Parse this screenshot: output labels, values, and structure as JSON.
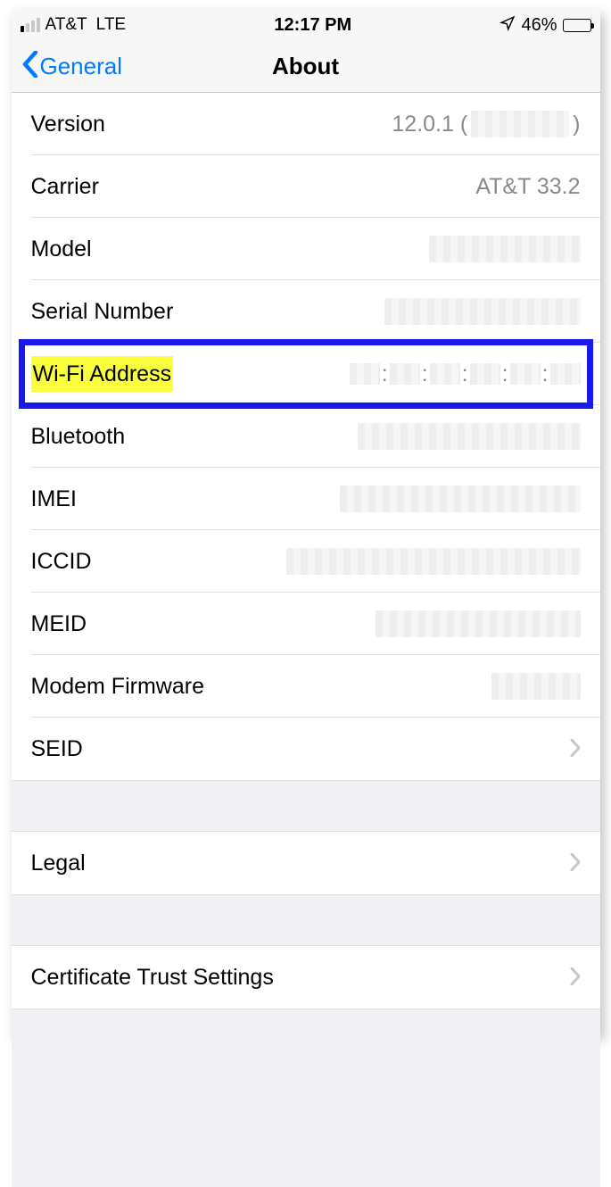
{
  "status": {
    "carrier": "AT&T",
    "network": "LTE",
    "time": "12:17 PM",
    "battery_percent": "46%",
    "battery_fill_pct": 46
  },
  "nav": {
    "back_label": "General",
    "title": "About"
  },
  "rows": {
    "version": {
      "label": "Version",
      "value_prefix": "12.0.1 (",
      "value_suffix": ")"
    },
    "carrier": {
      "label": "Carrier",
      "value": "AT&T 33.2"
    },
    "model": {
      "label": "Model"
    },
    "serial": {
      "label": "Serial Number"
    },
    "wifi": {
      "label": "Wi-Fi Address"
    },
    "bluetooth": {
      "label": "Bluetooth"
    },
    "imei": {
      "label": "IMEI"
    },
    "iccid": {
      "label": "ICCID"
    },
    "meid": {
      "label": "MEID"
    },
    "modem": {
      "label": "Modem Firmware"
    },
    "seid": {
      "label": "SEID"
    },
    "legal": {
      "label": "Legal"
    },
    "cert": {
      "label": "Certificate Trust Settings"
    }
  },
  "mac_separator": ":"
}
